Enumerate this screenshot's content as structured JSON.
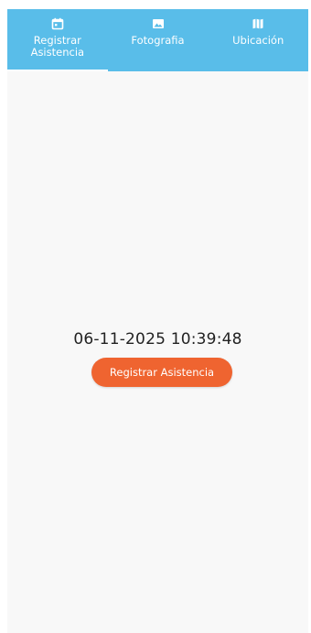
{
  "tabs": [
    {
      "label": "Registrar Asistencia",
      "icon": "calendar-icon",
      "active": true
    },
    {
      "label": "Fotografia",
      "icon": "image-icon",
      "active": false
    },
    {
      "label": "Ubicación",
      "icon": "map-icon",
      "active": false
    }
  ],
  "main": {
    "datetime": "06-11-2025 10:39:48",
    "register_button_label": "Registrar Asistencia"
  },
  "colors": {
    "tabbar": "#59bde9",
    "button": "#ef6430",
    "background": "#f8f8f8"
  }
}
